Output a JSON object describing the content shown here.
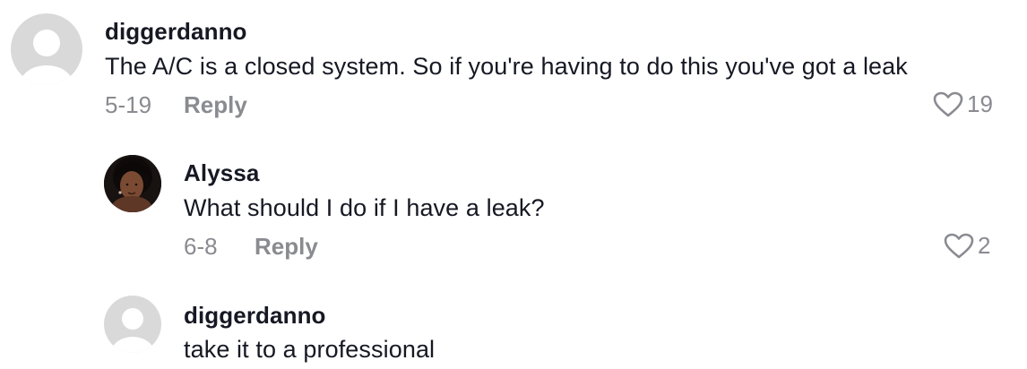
{
  "comments": [
    {
      "username": "diggerdanno",
      "text": "The A/C is a closed system. So if you're having to do this you've got a leak",
      "date": "5-19",
      "reply_label": "Reply",
      "likes": "19",
      "avatar": "default-avatar"
    },
    {
      "username": "Alyssa",
      "text": "What should I do if I have a leak?",
      "date": "6-8",
      "reply_label": "Reply",
      "likes": "2",
      "avatar": "photo-avatar"
    },
    {
      "username": "diggerdanno",
      "text": "take it to a professional",
      "avatar": "default-avatar"
    }
  ],
  "colors": {
    "text": "#161823",
    "muted": "#8a8b91",
    "avatar_bg": "#d9d9d9"
  }
}
